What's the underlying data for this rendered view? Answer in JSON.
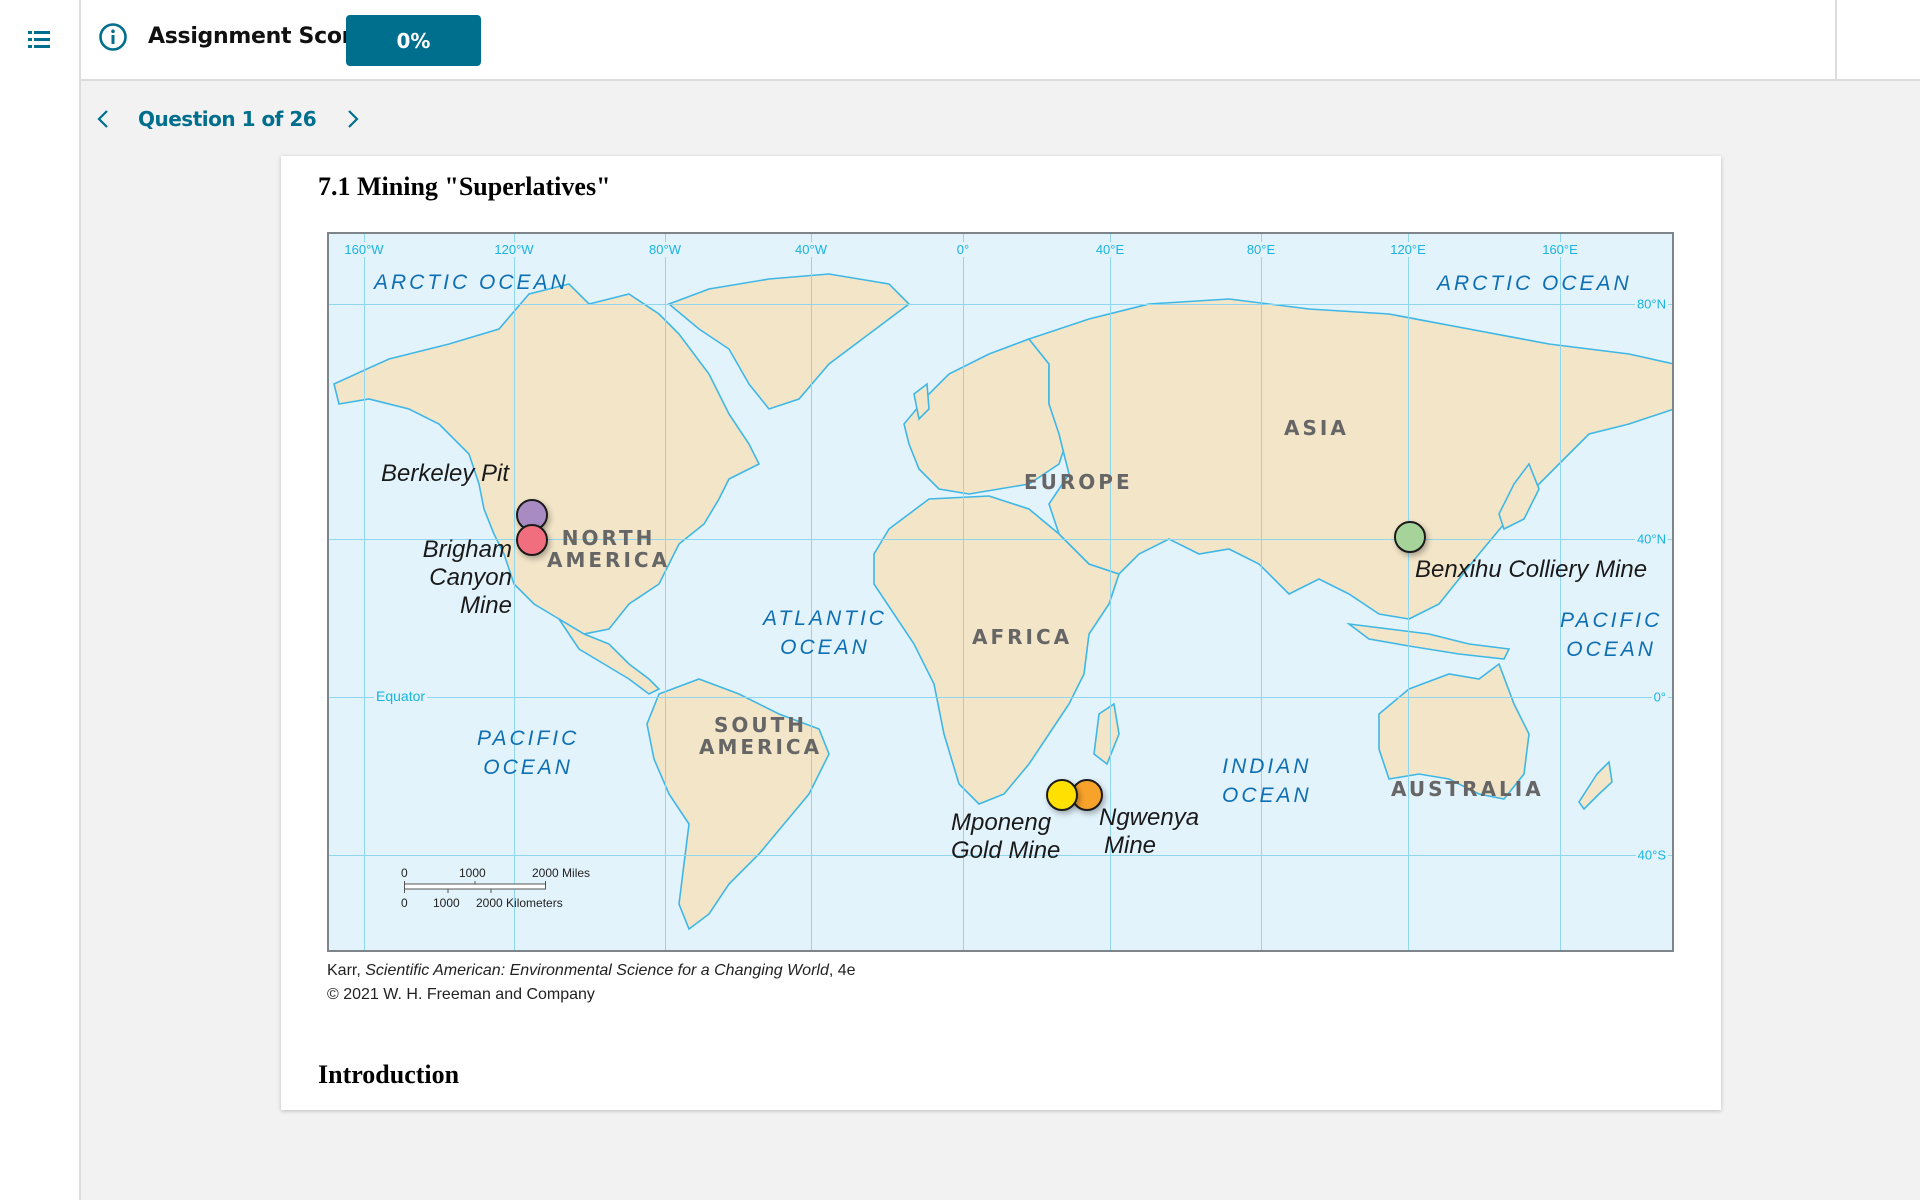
{
  "header": {
    "menu_icon": "list-icon",
    "info_icon": "info-circle-icon",
    "score_label": "Assignment Score:",
    "score_value": "0%"
  },
  "question_nav": {
    "label": "Question 1 of 26",
    "prev_icon": "chevron-left-icon",
    "next_icon": "chevron-right-icon"
  },
  "card": {
    "title": "7.1 Mining \"Superlatives\"",
    "section_heading": "Introduction",
    "credit_author": "Karr, ",
    "credit_title": "Scientific American: Environmental Science for a Changing World",
    "credit_edition": ", 4e",
    "credit_copyright": "© 2021 W. H. Freeman and Company"
  },
  "map": {
    "longitude_labels": [
      "160°W",
      "120°W",
      "80°W",
      "40°W",
      "0°",
      "40°E",
      "80°E",
      "120°E",
      "160°E"
    ],
    "latitude_labels": [
      "80°N",
      "40°N",
      "0°",
      "40°S"
    ],
    "equator_label": "Equator",
    "oceans": {
      "arctic_west": "ARCTIC OCEAN",
      "arctic_east": "ARCTIC OCEAN",
      "atlantic": [
        "ATLANTIC",
        "OCEAN"
      ],
      "pacific_west": [
        "PACIFIC",
        "OCEAN"
      ],
      "pacific_east": [
        "PACIFIC",
        "OCEAN"
      ],
      "indian": [
        "INDIAN",
        "OCEAN"
      ]
    },
    "continents": {
      "north_america": [
        "NORTH",
        "AMERICA"
      ],
      "south_america": [
        "SOUTH",
        "AMERICA"
      ],
      "europe": "EUROPE",
      "asia": "ASIA",
      "africa": "AFRICA",
      "australia": "AUSTRALIA"
    },
    "mines": [
      {
        "name": "Berkeley Pit",
        "label_lines": [
          "Berkeley Pit"
        ],
        "color": "#a98bc4"
      },
      {
        "name": "Brigham Canyon Mine",
        "label_lines": [
          "Brigham",
          "Canyon",
          "Mine"
        ],
        "color": "#f06e7e"
      },
      {
        "name": "Benxihu Colliery Mine",
        "label_lines": [
          "Benxihu Colliery Mine"
        ],
        "color": "#a6d39a"
      },
      {
        "name": "Mponeng Gold Mine",
        "label_lines": [
          "Mponeng",
          "Gold Mine"
        ],
        "color": "#ffe000"
      },
      {
        "name": "Ngwenya Mine",
        "label_lines": [
          "Ngwenya",
          "Mine"
        ],
        "color": "#f7a22a"
      }
    ],
    "scale": {
      "miles_ticks": [
        "0",
        "1000",
        "2000 Miles"
      ],
      "km_ticks": [
        "0",
        "1000",
        "2000 Kilometers"
      ]
    }
  },
  "colors": {
    "accent": "#006f8e",
    "ocean": "#e3f3fc",
    "land": "#f3e5c8",
    "grid": "#8fd6ee",
    "ocean_label": "#0e6fb3"
  }
}
